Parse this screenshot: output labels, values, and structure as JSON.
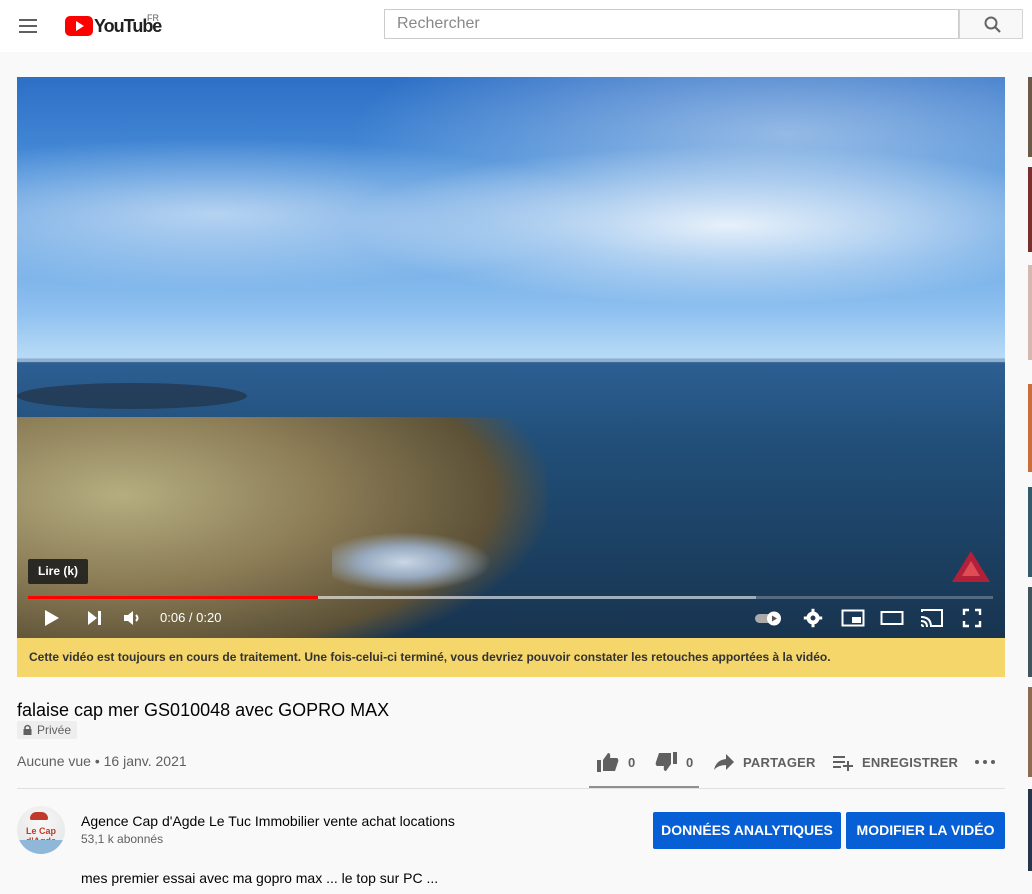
{
  "header": {
    "brand": "YouTube",
    "country": "FR",
    "search_placeholder": "Rechercher"
  },
  "player": {
    "tooltip": "Lire (k)",
    "current_time": "0:06",
    "separator": " / ",
    "duration": "0:20",
    "progress_fraction": 0.3,
    "colors": {
      "progress": "#ff0000"
    }
  },
  "notice": {
    "text": "Cette vidéo est toujours en cours de traitement. Une fois-celui-ci terminé, vous devriez pouvoir constater les retouches apportées à la vidéo."
  },
  "video": {
    "title": "falaise cap mer GS010048 avec GOPRO MAX",
    "privacy": "Privée",
    "views": "Aucune vue",
    "date_separator": " • ",
    "date": "16 janv. 2021"
  },
  "actions": {
    "likes": "0",
    "dislikes": "0",
    "share": "PARTAGER",
    "save": "ENREGISTRER"
  },
  "channel": {
    "avatar_text": "Le Cap d'Agde",
    "name": "Agence Cap d'Agde Le Tuc Immobilier vente achat locations",
    "subscribers": "53,1 k abonnés"
  },
  "buttons": {
    "analytics": "DONNÉES ANALYTIQUES",
    "edit": "MODIFIER LA VIDÉO"
  },
  "description": {
    "text": "mes premier essai avec ma gopro max ... le top sur PC ..."
  },
  "theme": {
    "accent": "#065fd4",
    "notice_bg": "#f5d66a"
  }
}
